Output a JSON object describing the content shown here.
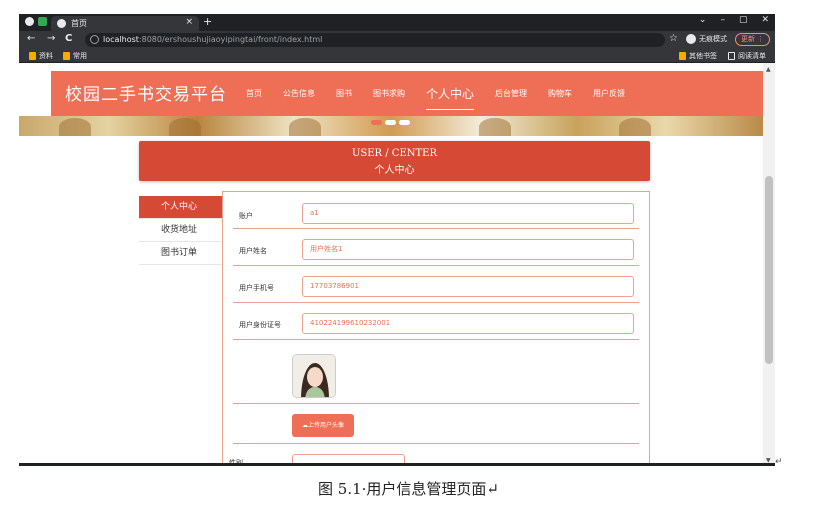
{
  "browser": {
    "tab_title": "首页",
    "tab_close": "×",
    "new_tab": "+",
    "window_controls": [
      "⌄",
      "–",
      "▢",
      "✕"
    ],
    "nav_back": "←",
    "nav_forward": "→",
    "nav_reload": "C",
    "url_host": "localhost",
    "url_path": ":8080/ershoushujiaoyipingtai/front/index.html",
    "star": "☆",
    "incognito_label": "无痕模式",
    "update_label": "更新 ⋮",
    "bookmarks": [
      "资料",
      "常用"
    ],
    "bookmarks_right": [
      "其他书签",
      "阅读清单"
    ]
  },
  "site": {
    "logo": "校园二手书交易平台",
    "nav": [
      "首页",
      "公告信息",
      "图书",
      "图书求购",
      "个人中心",
      "后台管理",
      "购物车",
      "用户反馈"
    ],
    "active_nav": "个人中心"
  },
  "user_center": {
    "title_en": "USER / CENTER",
    "title_zh": "个人中心",
    "side_menu": [
      "个人中心",
      "收货地址",
      "图书订单"
    ],
    "fields": [
      {
        "label": "账户",
        "value": "a1"
      },
      {
        "label": "用户姓名",
        "value": "用户姓名1"
      },
      {
        "label": "用户手机号",
        "value": "17703786901"
      },
      {
        "label": "用户身份证号",
        "value": "410224199610232001"
      }
    ],
    "upload_button": "上传用户头像",
    "gender_label": "性别"
  },
  "caption": "图 5.1·用户信息管理页面↵",
  "end_mark": "↵",
  "colors": {
    "accent": "#ee6f55",
    "accent_dark": "#d64a35",
    "chrome": "#202124"
  }
}
